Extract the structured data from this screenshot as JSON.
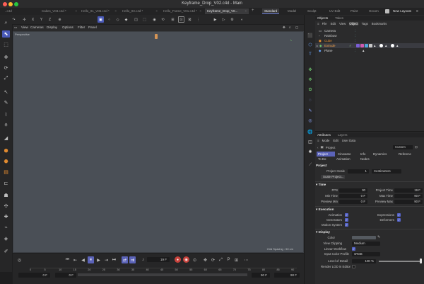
{
  "window": {
    "title": "Keyframe_Drop_V02.c4d - Main"
  },
  "tabs": [
    {
      "label": "..c4d"
    },
    {
      "label": "Cakes_V03.c4d *"
    },
    {
      "label": "Hello_01_V05.c4d *"
    },
    {
      "label": "Hello_03.c4d *"
    },
    {
      "label": "Hello_Frame_V01.c4d *"
    },
    {
      "label": "Keyframe_Drop_V0..."
    }
  ],
  "layouts": [
    "Standard",
    "Model",
    "Sculpt",
    "UV Edit",
    "Paint",
    "Groom",
    "New Layouts"
  ],
  "toolbar": {
    "axis_x": "X",
    "axis_y": "Y",
    "axis_z": "Z"
  },
  "viewport": {
    "menu": [
      "View",
      "Cameras",
      "Display",
      "Options",
      "Filter",
      "Panel"
    ],
    "camera_label": "Perspective",
    "grid_spacing": "Grid Spacing : 50 cm"
  },
  "timeline": {
    "current_frame": "19 F",
    "start_frame": "0 F",
    "start_frame2": "0 F",
    "end_frame": "90 F",
    "end_frame2": "90 F",
    "ruler_ticks": [
      "0",
      "5",
      "10",
      "15",
      "20",
      "25",
      "30",
      "35",
      "40",
      "45",
      "50",
      "55",
      "60",
      "65",
      "70",
      "75",
      "80",
      "85",
      "90"
    ]
  },
  "objects_panel": {
    "tabs": [
      "Objects",
      "Takes"
    ],
    "menu": [
      "File",
      "Edit",
      "View",
      "Object",
      "Tags",
      "Bookmarks"
    ],
    "items": [
      {
        "name": "Camera"
      },
      {
        "name": "Rainbow"
      },
      {
        "name": "Cube"
      },
      {
        "name": "Extrude"
      },
      {
        "name": "Plane"
      }
    ]
  },
  "attributes": {
    "tabs": [
      "Attributes",
      "Layers"
    ],
    "menu": [
      "Mode",
      "Edit",
      "User Data"
    ],
    "context": "Project",
    "dropdown": "Custom",
    "panel_tabs": [
      "Project",
      "Cineware",
      "Info",
      "Dynamics",
      "Referenc"
    ],
    "panel_tabs2": [
      "To Do",
      "Animation",
      "Nodes"
    ],
    "section_project": "Project",
    "project_scale_label": "Project Scale",
    "project_scale_value": "1",
    "project_scale_unit": "Centimeters",
    "scale_project_btn": "Scale Project...",
    "section_time": "Time",
    "fps_label": "FPS",
    "fps_value": "30",
    "project_time_label": "Project Time",
    "project_time_value": "19 F",
    "min_time_label": "Min Time",
    "min_time_value": "0 F",
    "max_time_label": "Max Time",
    "max_time_value": "90 F",
    "preview_min_label": "Preview Min",
    "preview_min_value": "0 F",
    "preview_max_label": "Preview Max",
    "preview_max_value": "90 F",
    "section_execution": "Execution",
    "animation_label": "Animation",
    "expressions_label": "Expressions",
    "generators_label": "Generators",
    "deformers_label": "Deformers",
    "motion_system_label": "Motion System",
    "section_display": "Display",
    "color_label": "Color",
    "view_clipping_label": "View Clipping",
    "view_clipping_value": "Medium",
    "linear_workflow_label": "Linear Workflow",
    "input_color_profile_label": "Input Color Profile",
    "input_color_profile_value": "sRGB",
    "level_of_detail_label": "Level of Detail",
    "level_of_detail_value": "100 %",
    "render_lod_label": "Render LOD in Editor"
  },
  "colors": {
    "accent": "#5b63b8",
    "viewport": "#4a4f56",
    "record": "#c7423c"
  }
}
